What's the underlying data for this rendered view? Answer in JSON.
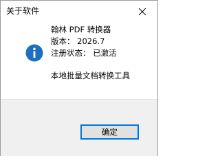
{
  "window": {
    "title": "关于软件"
  },
  "icons": {
    "close": "close-icon",
    "info": "info-icon"
  },
  "colors": {
    "info_icon_bg": "#1e6fbf",
    "button_border": "#0078d7",
    "footer_bg": "#f0f0f0"
  },
  "about": {
    "product_name": "翰林 PDF 转换器",
    "version": "版本： 2026.7",
    "registration": "注册状态： 已激活",
    "description": "本地批量文档转换工具"
  },
  "buttons": {
    "ok_label": "确定"
  }
}
